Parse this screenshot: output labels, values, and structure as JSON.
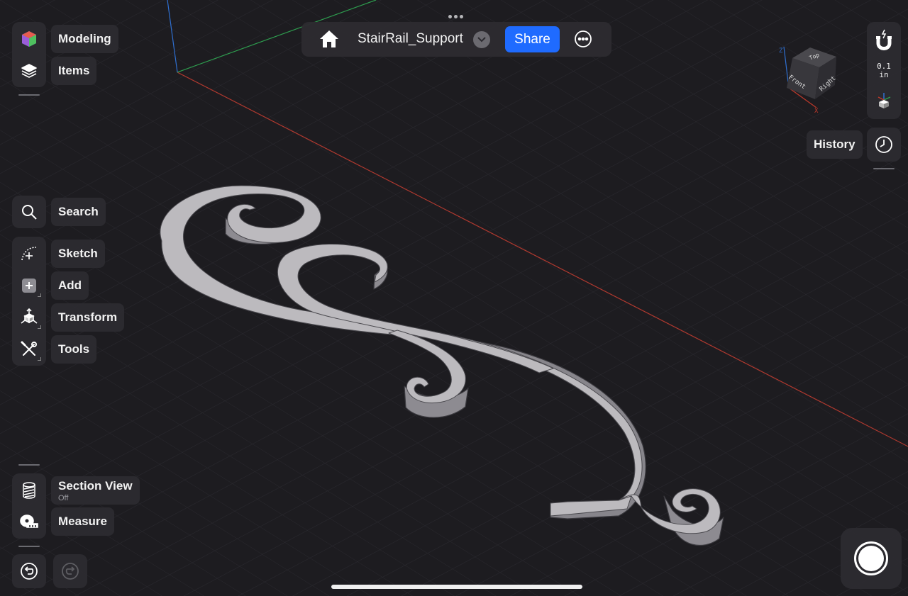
{
  "toolbar": {
    "document_title": "StairRail_Support",
    "share_label": "Share"
  },
  "left_panel": {
    "top_items": [
      {
        "label": "Modeling",
        "icon": "modeling-cube-icon"
      },
      {
        "label": "Items",
        "icon": "layers-icon"
      }
    ],
    "tools": [
      {
        "label": "Search",
        "icon": "search-icon"
      },
      {
        "label": "Sketch",
        "icon": "sketch-icon"
      },
      {
        "label": "Add",
        "icon": "add-icon"
      },
      {
        "label": "Transform",
        "icon": "transform-icon"
      },
      {
        "label": "Tools",
        "icon": "wrench-screwdriver-icon"
      }
    ],
    "bottom_items": {
      "section_view_label": "Section View",
      "section_view_state": "Off",
      "measure_label": "Measure"
    }
  },
  "right_panel": {
    "snap_value": "0.1",
    "snap_unit": "in",
    "history_label": "History"
  },
  "view_cube": {
    "top": "Top",
    "front": "Front",
    "right": "Right",
    "axis_z": "Z",
    "axis_x": "X"
  },
  "colors": {
    "accent": "#1f6bff",
    "background": "#1d1c20",
    "panel": "#2c2b30",
    "model_top": "#b9b7bb",
    "model_side": "#8a888e",
    "axis_x": "#c0392b",
    "axis_y": "#2e9e4f",
    "axis_z": "#2f6fd0"
  }
}
